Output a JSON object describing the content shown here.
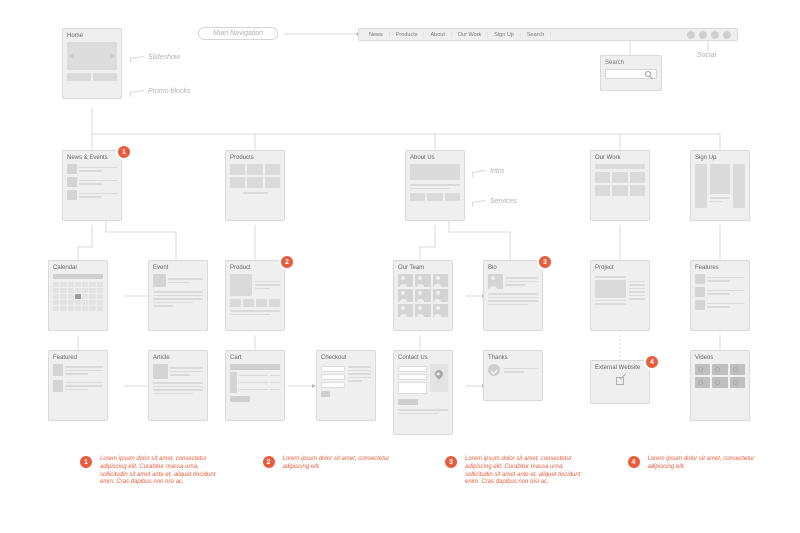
{
  "nav_caption": "Main Navigation",
  "nav": {
    "items": [
      "News",
      "Products",
      "About",
      "Our Work",
      "Sign Up",
      "Search"
    ]
  },
  "social_label": "Social",
  "search_popup": {
    "title": "Search"
  },
  "home": {
    "title": "Home"
  },
  "annotations": {
    "slideshow": "Slideshow",
    "promo": "Promo blocks",
    "intro": "Intro",
    "services": "Services"
  },
  "cards": {
    "news": "News & Events",
    "products": "Products",
    "about": "About Us",
    "ourwork": "Our Work",
    "signup": "Sign Up",
    "calendar": "Calendar",
    "event": "Event",
    "product": "Product",
    "ourteam": "Our Team",
    "bio": "Bio",
    "project": "Project",
    "features": "Features",
    "featured": "Featured",
    "article": "Article",
    "cart": "Cart",
    "checkout": "Checkout",
    "contact": "Contact Us",
    "thanks": "Thanks",
    "external": "External Website",
    "videos": "Videos"
  },
  "footnotes": [
    "Lorem ipsum dolor sit amet, consectetur adipiscing elit. Curabitur massa urna, sollicitudin sit amet ante et, aliquet tincidunt enim. Cras dapibus non nisi ac.",
    "Lorem ipsum dolor sit amet, consectetur adipiscing elit.",
    "Lorem ipsum dolor sit amet, consectetur adipiscing elit. Curabitur massa urna, sollicitudin sit amet ante et, aliquet tincidunt enim. Cras dapibus non nisi ac.",
    "Lorem ipsum dolor sit amet, consectetur adipiscing elit."
  ]
}
